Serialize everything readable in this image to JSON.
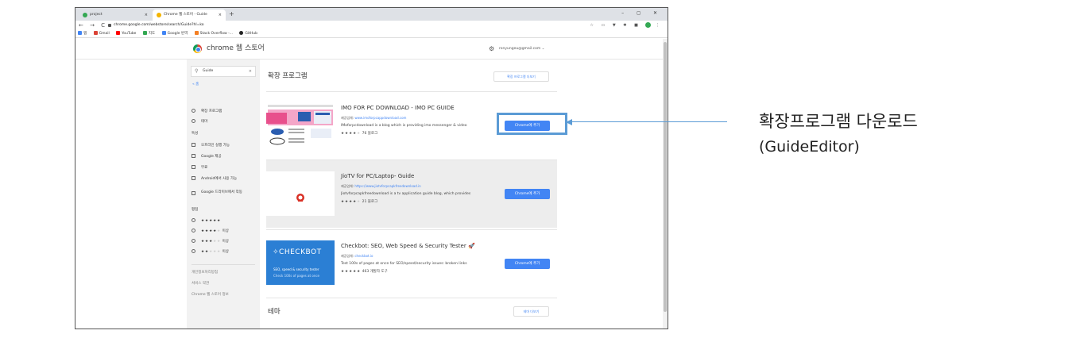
{
  "browser": {
    "tabs": [
      {
        "label": "project",
        "close": "×",
        "icon_color": "#34a853"
      },
      {
        "label": "Chrome 웹 스토어 - Guide",
        "close": "×",
        "icon_color": "#f4b400"
      }
    ],
    "new_tab": "+",
    "window_controls": "–  ◻  ✕",
    "url": "chrome.google.com/webstore/search/Guide?hl=ko",
    "nav_buttons": "← → C",
    "bookmarks": [
      {
        "label": "앱",
        "color": "#4285f4"
      },
      {
        "label": "Gmail",
        "color": "#db4437"
      },
      {
        "label": "YouTube",
        "color": "#ff0000"
      },
      {
        "label": "지도",
        "color": "#34a853"
      },
      {
        "label": "Google 번역",
        "color": "#4285f4"
      },
      {
        "label": "Stack Overflow -...",
        "color": "#f48024"
      },
      {
        "label": "GitHub",
        "color": "#222222"
      }
    ]
  },
  "store": {
    "title": "chrome 웹 스토어",
    "email": "ronyungeu@gmail.com ⌄"
  },
  "sidebar": {
    "search_value": "Guide",
    "search_clear": "×",
    "home_link": "« 홈",
    "type_items": [
      "확장 프로그램",
      "테마"
    ],
    "features_head": "특성",
    "feature_items": [
      "오프라인 실행 가능",
      "Google 제공",
      "무료",
      "Android에서 사용 가능",
      "Google 드라이브에서 작동"
    ],
    "rating_head": "평점",
    "ratings": [
      {
        "on": "★★★★★",
        "off": "",
        "suffix": ""
      },
      {
        "on": "★★★★",
        "off": "★",
        "suffix": "이상"
      },
      {
        "on": "★★★",
        "off": "★★",
        "suffix": "이상"
      },
      {
        "on": "★★",
        "off": "★★★",
        "suffix": "이상"
      }
    ],
    "footer_links": [
      "개인정보처리방침",
      "서비스 약관",
      "Chrome 웹 스토어 정보"
    ]
  },
  "main": {
    "section_title": "확장 프로그램",
    "see_more": "확장 프로그램 더보기",
    "extensions": [
      {
        "title": "IMO FOR PC DOWNLOAD - IMO PC GUIDE",
        "provider_label": "제공업체:",
        "provider": "www.imoforpcappdownload.com",
        "description": "IMoforpcdownload is a blog which is providing imo messenger & video",
        "stars_on": "★★★★",
        "stars_off": "★",
        "rating_count": "76",
        "category": "블로그",
        "button": "Chrome에 추가"
      },
      {
        "title": "JioTV for PC/Laptop- Guide",
        "provider_label": "제공업체:",
        "provider": "https://www.jiotvforpcapkfreedownload.in",
        "description": "Jiotvforpcapkfreedownload is a tv application guide blog, which provides",
        "stars_on": "★★★★",
        "stars_off": "★",
        "rating_count": "21",
        "category": "블로그",
        "button": "Chrome에 추가"
      },
      {
        "title": "Checkbot: SEO, Web Speed & Security Tester",
        "provider_label": "제공업체:",
        "provider": "checkbot.io",
        "description": "Test 100s of pages at once for SEO/speed/security issues: broken links",
        "stars_on": "★★★★★",
        "stars_off": "",
        "rating_count": "463",
        "category": "개발자 도구",
        "button": "Chrome에 추가",
        "thumb_brand": "CHECKBOT",
        "thumb_line1": "SEO, speed & security tester",
        "thumb_line2": "Check 100s of pages at once"
      }
    ],
    "theme_title": "테마",
    "theme_more": "테마 더보기"
  },
  "annotation": {
    "title": "확장프로그램 다운로드",
    "subtitle": "(GuideEditor)",
    "color": "#5b9bd5"
  }
}
